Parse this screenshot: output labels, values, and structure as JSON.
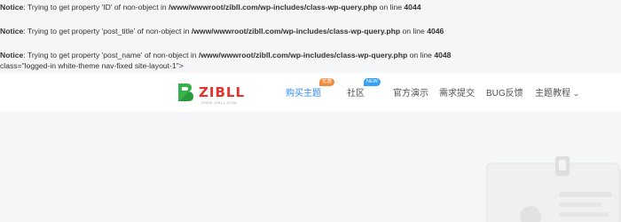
{
  "notices": [
    {
      "label": "Notice",
      "text": ": Trying to get property 'ID' of non-object in ",
      "path": "/www/wwwroot/zibll.com/wp-includes/class-wp-query.php",
      "line_text": " on line ",
      "line": "4044"
    },
    {
      "label": "Notice",
      "text": ": Trying to get property 'post_title' of non-object in ",
      "path": "/www/wwwroot/zibll.com/wp-includes/class-wp-query.php",
      "line_text": " on line ",
      "line": "4046"
    },
    {
      "label": "Notice",
      "text": ": Trying to get property 'post_name' of non-object in ",
      "path": "/www/wwwroot/zibll.com/wp-includes/class-wp-query.php",
      "line_text": " on line ",
      "line": "4048"
    }
  ],
  "leaked_attr": "class=\"logged-in white-theme nav-fixed site-layout-1\">",
  "logo": {
    "text": "ZIBLL",
    "sub": "WWW.ZIBLL.COM"
  },
  "nav": [
    {
      "label": "购买主题",
      "badge": "优惠",
      "active": true
    },
    {
      "label": "社区",
      "badge": "NEW"
    },
    {
      "label": "官方演示"
    },
    {
      "label": "需求提交"
    },
    {
      "label": "BUG反馈"
    },
    {
      "label": "主题教程"
    }
  ],
  "colors": {
    "accent": "#2d8cf0",
    "logo_green": "#35b34a",
    "logo_red": "#e0342f",
    "badge_hot": "#f08c3e",
    "badge_new": "#38a0f5"
  },
  "icons": {
    "dropdown": "chevron-down-icon"
  }
}
